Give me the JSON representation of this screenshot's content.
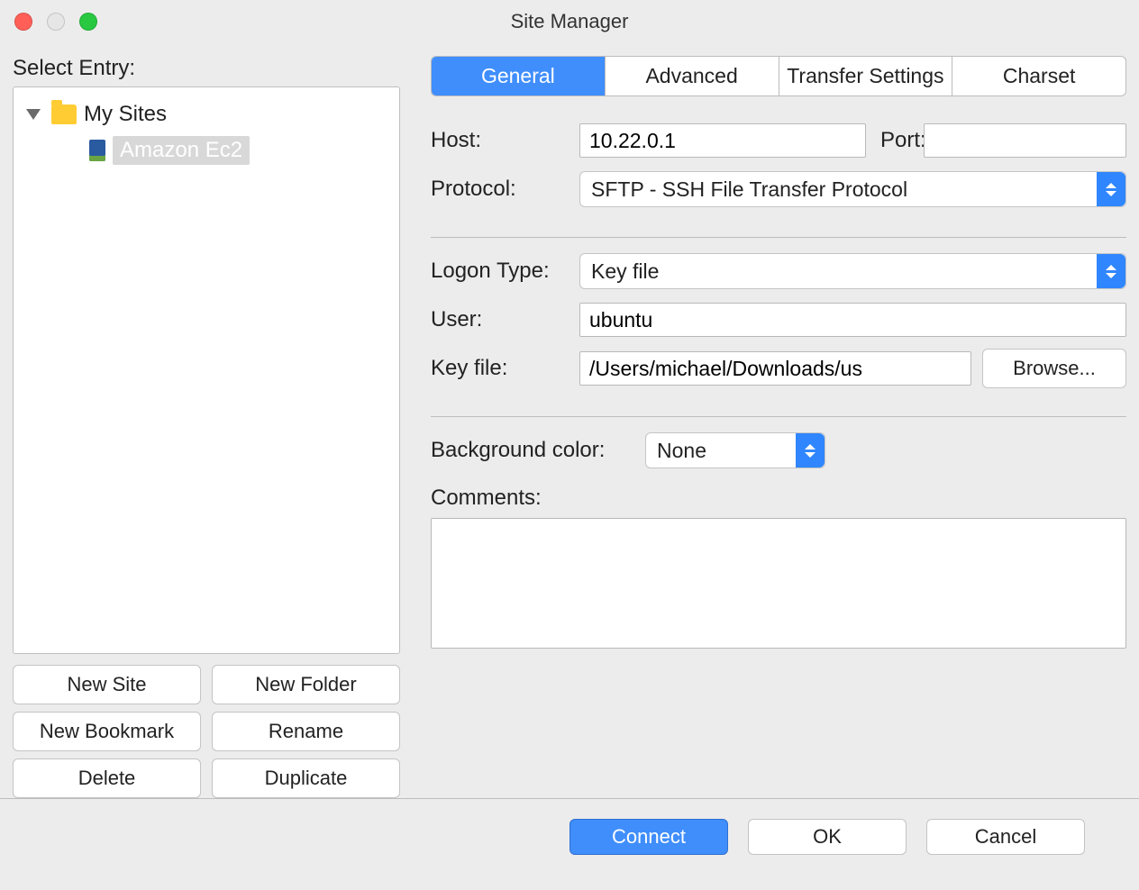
{
  "titlebar": {
    "title": "Site Manager"
  },
  "left": {
    "select_entry_label": "Select Entry:",
    "root_folder": "My Sites",
    "site_name": "Amazon Ec2",
    "buttons": {
      "new_site": "New Site",
      "new_folder": "New Folder",
      "new_bookmark": "New Bookmark",
      "rename": "Rename",
      "delete": "Delete",
      "duplicate": "Duplicate"
    }
  },
  "tabs": {
    "general": "General",
    "advanced": "Advanced",
    "transfer": "Transfer Settings",
    "charset": "Charset"
  },
  "form": {
    "host_label": "Host:",
    "host_value": "10.22.0.1",
    "port_label": "Port:",
    "port_value": "",
    "protocol_label": "Protocol:",
    "protocol_value": "SFTP - SSH File Transfer Protocol",
    "logon_type_label": "Logon Type:",
    "logon_type_value": "Key file",
    "user_label": "User:",
    "user_value": "ubuntu",
    "keyfile_label": "Key file:",
    "keyfile_value": "/Users/michael/Downloads/us",
    "browse_label": "Browse...",
    "bgcolor_label": "Background color:",
    "bgcolor_value": "None",
    "comments_label": "Comments:",
    "comments_value": ""
  },
  "footer": {
    "connect": "Connect",
    "ok": "OK",
    "cancel": "Cancel"
  }
}
